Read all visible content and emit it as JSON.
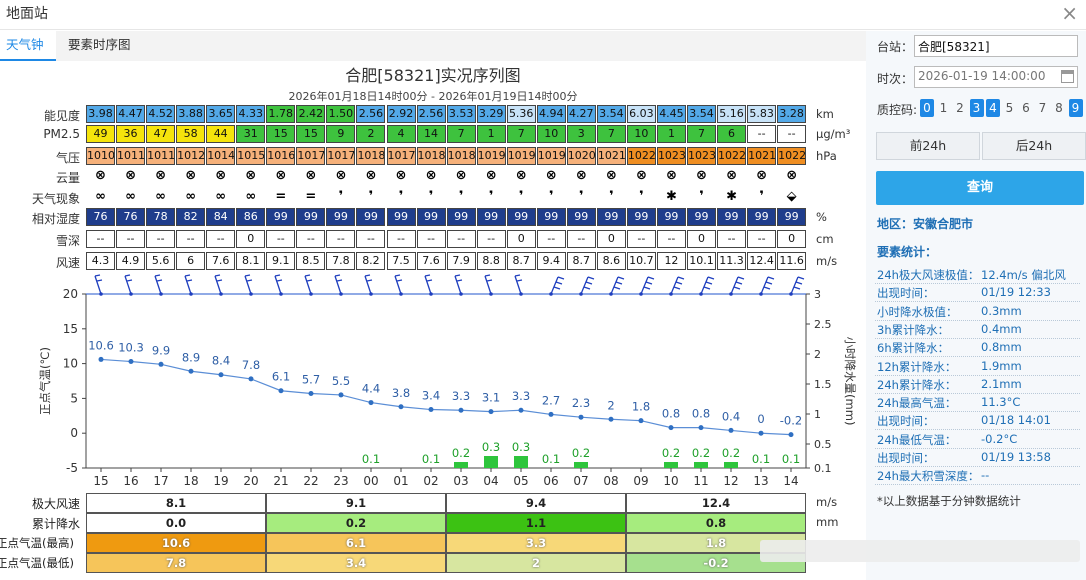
{
  "window": {
    "title": "地面站",
    "close_symbol": "×"
  },
  "tabs": [
    {
      "label": "天气钟",
      "active": true
    },
    {
      "label": "要素时序图",
      "active": false
    }
  ],
  "chart": {
    "title": "合肥[58321]实况序列图",
    "subtitle": "2026年01月18日14时00分 - 2026年01月19日14时00分"
  },
  "table": {
    "rows": [
      {
        "label": "能见度",
        "unit": "km",
        "values": [
          "3.98",
          "4.47",
          "4.52",
          "3.88",
          "3.65",
          "4.33",
          "1.78",
          "2.42",
          "1.50",
          "2.56",
          "2.92",
          "2.56",
          "3.53",
          "3.29",
          "5.36",
          "4.94",
          "4.27",
          "3.54",
          "6.03",
          "4.45",
          "3.54",
          "5.16",
          "5.83",
          "3.28"
        ],
        "colors": [
          "#53a9e8",
          "#53a9e8",
          "#53a9e8",
          "#53a9e8",
          "#53a9e8",
          "#53a9e8",
          "#3ec23e",
          "#3ec23e",
          "#3ec23e",
          "#53a9e8",
          "#53a9e8",
          "#53a9e8",
          "#53a9e8",
          "#53a9e8",
          "#c8e3f8",
          "#53a9e8",
          "#53a9e8",
          "#53a9e8",
          "#c8e3f8",
          "#53a9e8",
          "#53a9e8",
          "#c8e3f8",
          "#c8e3f8",
          "#53a9e8"
        ]
      },
      {
        "label": "PM2.5",
        "unit": "μg/m³",
        "values": [
          "49",
          "36",
          "47",
          "58",
          "44",
          "31",
          "15",
          "15",
          "9",
          "2",
          "4",
          "14",
          "7",
          "1",
          "7",
          "10",
          "3",
          "7",
          "10",
          "1",
          "7",
          "6",
          "--",
          "--"
        ],
        "colors": [
          "#f5e40c",
          "#f5e40c",
          "#f5e40c",
          "#f5e40c",
          "#f5e40c",
          "#3ec23e",
          "#3ec23e",
          "#3ec23e",
          "#3ec23e",
          "#3ec23e",
          "#3ec23e",
          "#3ec23e",
          "#3ec23e",
          "#3ec23e",
          "#3ec23e",
          "#3ec23e",
          "#3ec23e",
          "#3ec23e",
          "#3ec23e",
          "#3ec23e",
          "#3ec23e",
          "#3ec23e",
          "#ffffff",
          "#ffffff"
        ]
      },
      {
        "label": "气压",
        "unit": "hPa",
        "values": [
          "1010",
          "1011",
          "1011",
          "1012",
          "1014",
          "1015",
          "1016",
          "1017",
          "1017",
          "1018",
          "1017",
          "1018",
          "1018",
          "1019",
          "1019",
          "1019",
          "1020",
          "1021",
          "1022",
          "1023",
          "1023",
          "1022",
          "1021",
          "1022"
        ],
        "colors": [
          "#f6b17a",
          "#f6b17a",
          "#f6b17a",
          "#f6b17a",
          "#f6b17a",
          "#f6b17a",
          "#f6b17a",
          "#f6b17a",
          "#f6b17a",
          "#f6b17a",
          "#f6b17a",
          "#f6b17a",
          "#f6b17a",
          "#f6b17a",
          "#f6b17a",
          "#f6b17a",
          "#f6b17a",
          "#f6b17a",
          "#ef8e22",
          "#ef8e22",
          "#ef8e22",
          "#ef8e22",
          "#ef8e22",
          "#ef8e22"
        ]
      },
      {
        "label": "云量",
        "unit": "",
        "values": [
          "⊗",
          "⊗",
          "⊗",
          "⊗",
          "⊗",
          "⊗",
          "⊗",
          "⊗",
          "⊗",
          "⊗",
          "⊗",
          "⊗",
          "⊗",
          "⊗",
          "⊗",
          "⊗",
          "⊗",
          "⊗",
          "⊗",
          "⊗",
          "⊗",
          "⊗",
          "⊗",
          "⊗"
        ],
        "colors": []
      },
      {
        "label": "天气现象",
        "unit": "",
        "values": [
          "∞",
          "∞",
          "∞",
          "∞",
          "∞",
          "∞",
          "=",
          "=",
          "❜",
          "❜",
          "❜",
          "❜",
          "❜",
          "❜",
          "❜",
          "❜",
          "❜",
          "❜",
          "❜",
          "✱",
          "❜",
          "✱",
          "❜",
          "⬙"
        ],
        "colors": []
      },
      {
        "label": "相对湿度",
        "unit": "%",
        "values": [
          "76",
          "76",
          "78",
          "82",
          "84",
          "86",
          "99",
          "99",
          "99",
          "99",
          "99",
          "99",
          "99",
          "99",
          "99",
          "99",
          "99",
          "99",
          "99",
          "99",
          "99",
          "99",
          "99",
          "99"
        ],
        "colors": [
          "#1f3d8c",
          "#1f3d8c",
          "#1f3d8c",
          "#1f3d8c",
          "#1f3d8c",
          "#1f3d8c",
          "#1f3d8c",
          "#1f3d8c",
          "#1f3d8c",
          "#1f3d8c",
          "#1f3d8c",
          "#1f3d8c",
          "#1f3d8c",
          "#1f3d8c",
          "#1f3d8c",
          "#1f3d8c",
          "#1f3d8c",
          "#1f3d8c",
          "#1f3d8c",
          "#1f3d8c",
          "#1f3d8c",
          "#1f3d8c",
          "#1f3d8c",
          "#1f3d8c"
        ]
      },
      {
        "label": "雪深",
        "unit": "cm",
        "values": [
          "--",
          "--",
          "--",
          "--",
          "--",
          "0",
          "--",
          "--",
          "--",
          "--",
          "--",
          "--",
          "--",
          "--",
          "0",
          "--",
          "--",
          "0",
          "--",
          "--",
          "0",
          "--",
          "--",
          "0"
        ],
        "colors": []
      },
      {
        "label": "风速",
        "unit": "m/s",
        "values": [
          "4.3",
          "4.9",
          "5.6",
          "6",
          "7.6",
          "8.1",
          "9.1",
          "8.5",
          "7.8",
          "8.2",
          "7.5",
          "7.6",
          "7.9",
          "8.8",
          "8.7",
          "9.4",
          "8.7",
          "8.6",
          "10.7",
          "12",
          "10.1",
          "11.3",
          "12.4",
          "11.6"
        ],
        "colors": []
      }
    ]
  },
  "chart_data": {
    "type": "line",
    "x": [
      "15",
      "16",
      "17",
      "18",
      "19",
      "20",
      "21",
      "22",
      "23",
      "00",
      "01",
      "02",
      "03",
      "04",
      "05",
      "06",
      "07",
      "08",
      "09",
      "10",
      "11",
      "12",
      "13",
      "14"
    ],
    "series": [
      {
        "values": [
          10.6,
          10.3,
          9.9,
          8.9,
          8.4,
          7.8,
          6.1,
          5.7,
          5.5,
          4.4,
          3.8,
          3.4,
          3.3,
          3.1,
          3.3,
          2.7,
          2.3,
          2,
          1.8,
          0.8,
          0.8,
          0.4,
          0,
          -0.2
        ],
        "color": "#5b8ed6",
        "axis": "left"
      },
      {
        "type": "bar",
        "values": [
          null,
          null,
          null,
          null,
          null,
          null,
          null,
          null,
          null,
          0.1,
          null,
          0.1,
          0.2,
          0.3,
          0.3,
          0.1,
          0.2,
          null,
          null,
          0.2,
          0.2,
          0.2,
          0.1,
          0.1
        ],
        "color": "#2ec53c",
        "axis": "right"
      }
    ],
    "ylabel_left": "正点气温(℃)",
    "ylabel_right": "小时降水量(mm)",
    "ylim_left": [
      -5,
      20
    ],
    "ylim_right": [
      0.1,
      3
    ],
    "yticks_left": [
      "20",
      "15",
      "10",
      "5",
      "0",
      "-5"
    ],
    "yticks_right": [
      "3",
      "2.5",
      "2",
      "1.5",
      "1",
      "0.5",
      "0.1"
    ],
    "wind_barbs": true
  },
  "bottom_table": {
    "rows": [
      {
        "label": "极大风速",
        "unit": "m/s",
        "values": [
          "8.1",
          "9.1",
          "9.4",
          "12.4"
        ],
        "colors": [
          "#ffffff",
          "#ffffff",
          "#ffffff",
          "#ffffff"
        ]
      },
      {
        "label": "累计降水",
        "unit": "mm",
        "values": [
          "0.0",
          "0.2",
          "1.1",
          "0.8"
        ],
        "colors": [
          "#ffffff",
          "#a6ec7e",
          "#3cc213",
          "#a6ec7e"
        ]
      },
      {
        "label": "正点气温(最高)",
        "unit": "",
        "values": [
          "10.6",
          "6.1",
          "3.3",
          "1.8"
        ],
        "colors": [
          "#ef9a10",
          "#f6c55a",
          "#f7d878",
          "#d7e6a0"
        ]
      },
      {
        "label": "正点气温(最低)",
        "unit": "",
        "values": [
          "7.8",
          "3.4",
          "2",
          "-0.2"
        ],
        "colors": [
          "#f6c55a",
          "#f7d878",
          "#d7e6a0",
          "#a6e08e"
        ]
      }
    ]
  },
  "sidebar": {
    "station_label": "台站：",
    "station_value": "合肥[58321]",
    "time_label": "时次：",
    "time_value": "2026-01-19 14:00:00",
    "qc_label": "质控码:",
    "qc_codes": [
      {
        "v": "0",
        "on": true
      },
      {
        "v": "1",
        "on": false
      },
      {
        "v": "2",
        "on": false
      },
      {
        "v": "3",
        "on": true
      },
      {
        "v": "4",
        "on": true
      },
      {
        "v": "5",
        "on": false
      },
      {
        "v": "6",
        "on": false
      },
      {
        "v": "7",
        "on": false
      },
      {
        "v": "8",
        "on": false
      },
      {
        "v": "9",
        "on": true
      }
    ],
    "prev_label": "前24h",
    "next_label": "后24h",
    "query_label": "查询",
    "region": "地区：安徽合肥市",
    "stats_title": "要素统计：",
    "stats": [
      {
        "k": "24h极大风速极值：",
        "v": "12.4m/s 偏北风"
      },
      {
        "k": "出现时间：",
        "v": "01/19 12:33"
      },
      {
        "k": "小时降水极值：",
        "v": "0.3mm"
      },
      {
        "k": "3h累计降水：",
        "v": "0.4mm"
      },
      {
        "k": "6h累计降水：",
        "v": "0.8mm"
      },
      {
        "k": "12h累计降水：",
        "v": "1.9mm"
      },
      {
        "k": "24h累计降水：",
        "v": "2.1mm"
      },
      {
        "k": "24h最高气温：",
        "v": "11.3°C"
      },
      {
        "k": "出现时间：",
        "v": "01/18 14:01"
      },
      {
        "k": "24h最低气温：",
        "v": "-0.2°C"
      },
      {
        "k": "出现时间：",
        "v": "01/19 13:58"
      },
      {
        "k": "24h最大积雪深度：",
        "v": "--"
      }
    ],
    "note": "*以上数据基于分钟数据统计"
  }
}
